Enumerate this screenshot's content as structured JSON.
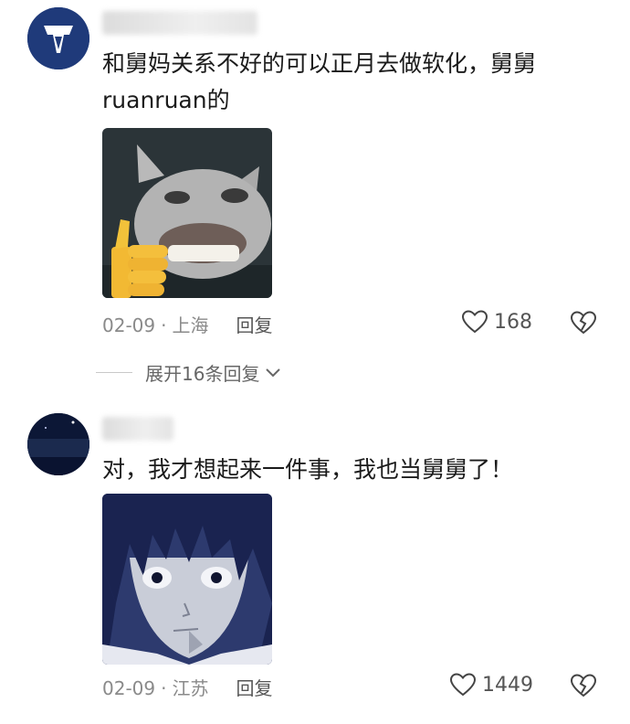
{
  "comments": [
    {
      "username": "用户",
      "text": "和舅妈关系不好的可以正月去做软化，舅舅ruanruan的",
      "date": "02-09",
      "location": "上海",
      "reply_label": "回复",
      "likes": "168",
      "icons": {
        "like": "heart-outline-icon",
        "dislike": "broken-heart-icon",
        "sticker": "thumbs-up-cat-sticker"
      }
    },
    {
      "username": "用户",
      "text": "对，我才想起来一件事，我也当舅舅了！",
      "date": "02-09",
      "location": "江苏",
      "reply_label": "回复",
      "likes": "1449",
      "icons": {
        "like": "heart-outline-icon",
        "dislike": "broken-heart-icon",
        "sticker": "anime-character-sticker"
      }
    }
  ],
  "expand_replies": {
    "label": "展开16条回复"
  },
  "colors": {
    "meta_gray": "#8a8a8a",
    "text": "#1b1b1b",
    "avatar1": "#1f3a7a"
  }
}
